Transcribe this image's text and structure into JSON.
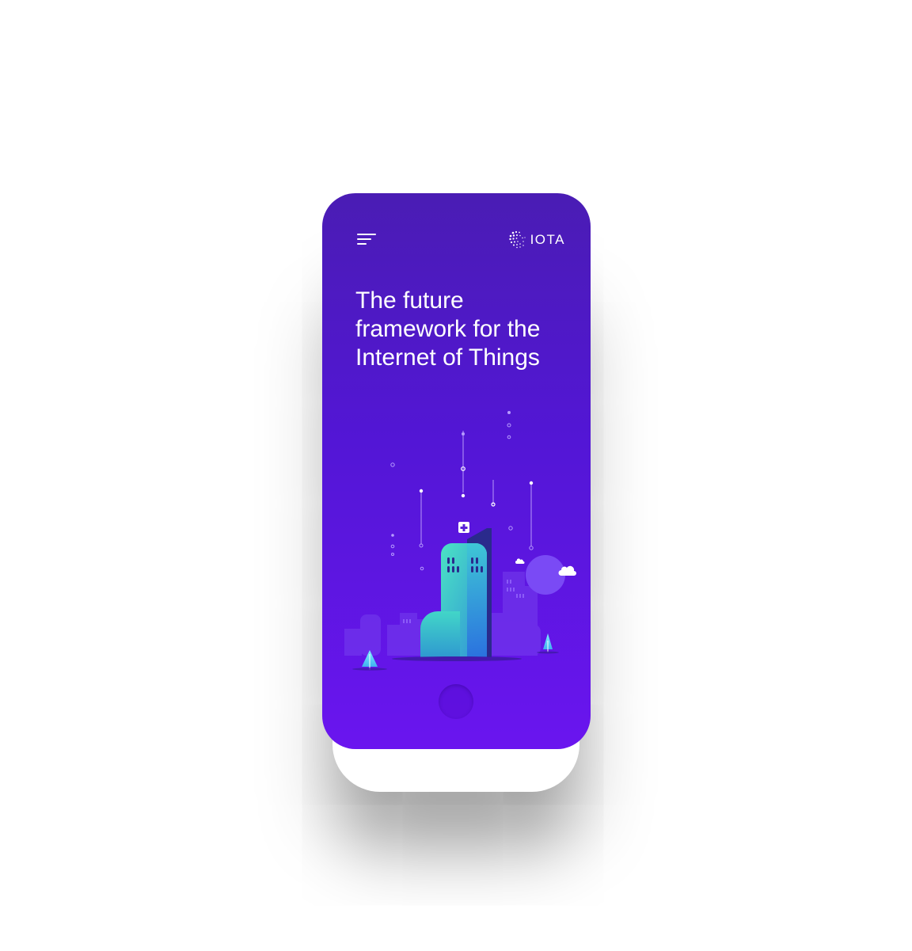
{
  "header": {
    "menu_icon": "hamburger-menu-icon",
    "logo_icon": "iota-logo-mark-icon",
    "logo_text": "IOTA"
  },
  "hero": {
    "headline": "The future framework for the Internet of Things"
  },
  "colors": {
    "background_top": "#4a1cb4",
    "background_bottom": "#6a15ef",
    "text": "#ffffff",
    "building_accent": "#4be3c4"
  }
}
